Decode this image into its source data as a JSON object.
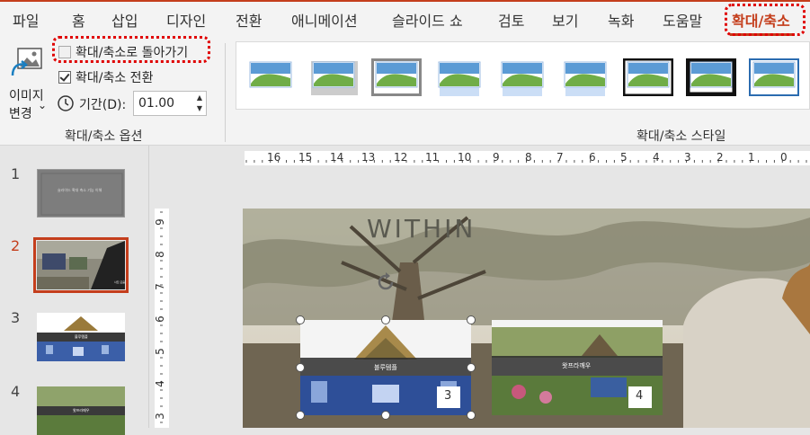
{
  "tabs": [
    "파일",
    "홈",
    "삽입",
    "디자인",
    "전환",
    "애니메이션",
    "슬라이드 쇼",
    "검토",
    "보기",
    "녹화",
    "도움말",
    "확대/축소"
  ],
  "active_tab": "확대/축소",
  "ribbon": {
    "change_image": {
      "line1": "이미지",
      "line2": "변경",
      "caret": "⌄"
    },
    "options": {
      "return_to_zoom": {
        "label": "확대/축소로 돌아가기",
        "checked": false
      },
      "zoom_transition": {
        "label": "확대/축소 전환",
        "checked": true
      },
      "duration": {
        "label": "기간(D):",
        "value": "01.00",
        "up": "▲",
        "down": "▼"
      }
    },
    "group_options_label": "확대/축소 옵션",
    "group_styles_label": "확대/축소 스타일",
    "styles_count": 9
  },
  "thumbnails": [
    {
      "number": "1",
      "caption": "슬라이드 확대 축소 기능 이해"
    },
    {
      "number": "2",
      "caption": "사진 모음"
    },
    {
      "number": "3",
      "caption": "블루템플"
    },
    {
      "number": "4",
      "caption": "왓프라깨우"
    }
  ],
  "ruler": {
    "horizontal": [
      "16",
      "15",
      "14",
      "13",
      "12",
      "11",
      "10",
      "9",
      "8",
      "7",
      "6",
      "5",
      "4",
      "3",
      "2",
      "1",
      "0"
    ],
    "vertical": [
      "9",
      "8",
      "7",
      "6",
      "5",
      "4",
      "3"
    ]
  },
  "slide": {
    "title": "WITHIN",
    "zoom_blue_temple": {
      "label": "블루템플",
      "badge": "3"
    },
    "zoom_wat_phra_kaew": {
      "label": "왓프라깨우",
      "badge": "4"
    }
  },
  "colors": {
    "accent": "#c43e1c",
    "highlight": "#e00000"
  }
}
